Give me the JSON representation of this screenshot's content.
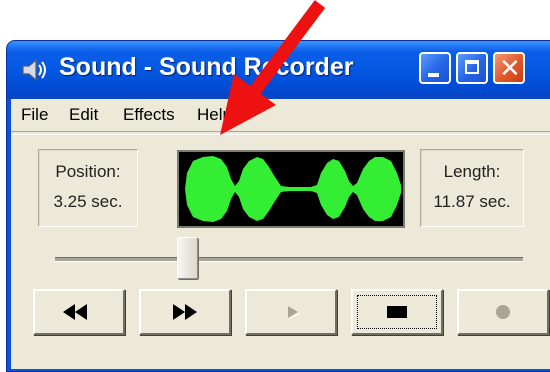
{
  "window": {
    "title": "Sound - Sound Recorder",
    "icon": "speaker-icon"
  },
  "menu": {
    "items": [
      "File",
      "Edit",
      "Effects",
      "Help"
    ]
  },
  "readouts": {
    "position_label": "Position:",
    "position_value": "3.25 sec.",
    "length_label": "Length:",
    "length_value": "11.87 sec."
  },
  "waveform": {
    "color": "#33ee33",
    "background": "#000000"
  },
  "slider": {
    "position_fraction": 0.274
  },
  "controls": [
    {
      "name": "seek-to-start",
      "icon": "rewind-icon",
      "enabled": true
    },
    {
      "name": "seek-to-end",
      "icon": "fast-forward-icon",
      "enabled": true
    },
    {
      "name": "play",
      "icon": "play-icon",
      "enabled": false
    },
    {
      "name": "stop",
      "icon": "stop-icon",
      "enabled": true,
      "focused": true
    },
    {
      "name": "record",
      "icon": "record-icon",
      "enabled": false
    }
  ],
  "annotation": {
    "arrow_color": "#ee1111"
  }
}
